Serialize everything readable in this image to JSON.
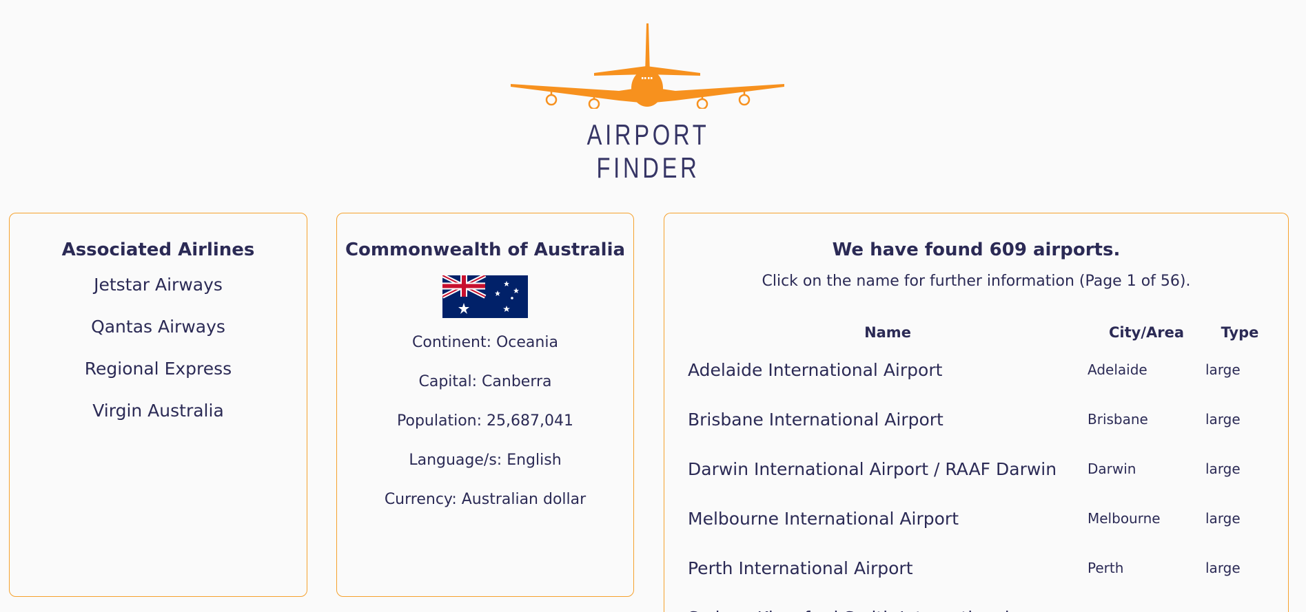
{
  "header": {
    "logo_text": "AIRPORT FINDER",
    "brand_color": "#f7911e"
  },
  "airlines": {
    "title": "Associated Airlines",
    "items": [
      "Jetstar Airways",
      "Qantas Airways",
      "Regional Express",
      "Virgin Australia"
    ]
  },
  "country": {
    "name": "Commonwealth of Australia",
    "continent": "Continent: Oceania",
    "capital": "Capital: Canberra",
    "population": "Population: 25,687,041",
    "languages": "Language/s: English",
    "currency": "Currency: Australian dollar"
  },
  "airports": {
    "title": "We have found 609 airports.",
    "subtitle": "Click on the name for further information (Page 1 of 56).",
    "columns": [
      "Name",
      "City/Area",
      "Type"
    ],
    "rows": [
      {
        "name": "Adelaide International Airport",
        "city": "Adelaide",
        "type": "large"
      },
      {
        "name": "Brisbane International Airport",
        "city": "Brisbane",
        "type": "large"
      },
      {
        "name": "Darwin International Airport / RAAF Darwin",
        "city": "Darwin",
        "type": "large"
      },
      {
        "name": "Melbourne International Airport",
        "city": "Melbourne",
        "type": "large"
      },
      {
        "name": "Perth International Airport",
        "city": "Perth",
        "type": "large"
      },
      {
        "name": "Sydney Kingsford Smith International",
        "city": "",
        "type": ""
      }
    ]
  }
}
